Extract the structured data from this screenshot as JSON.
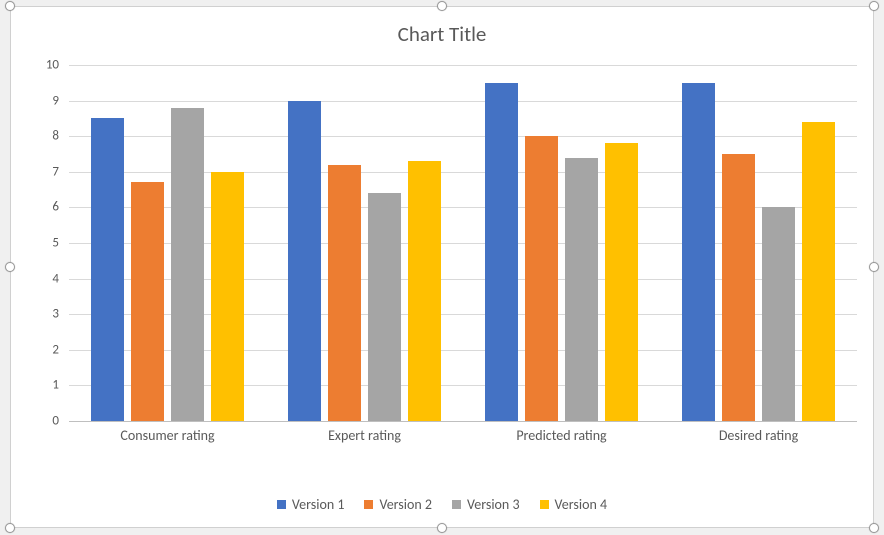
{
  "chart_data": {
    "type": "bar",
    "title": "Chart Title",
    "xlabel": "",
    "ylabel": "",
    "ylim": [
      0,
      10
    ],
    "yticks": [
      0,
      1,
      2,
      3,
      4,
      5,
      6,
      7,
      8,
      9,
      10
    ],
    "categories": [
      "Consumer rating",
      "Expert rating",
      "Predicted rating",
      "Desired rating"
    ],
    "series": [
      {
        "name": "Version 1",
        "color": "#4472c4",
        "values": [
          8.5,
          9.0,
          9.5,
          9.5
        ]
      },
      {
        "name": "Version 2",
        "color": "#ed7d31",
        "values": [
          6.7,
          7.2,
          8.0,
          7.5
        ]
      },
      {
        "name": "Version 3",
        "color": "#a5a5a5",
        "values": [
          8.8,
          6.4,
          7.4,
          6.0
        ]
      },
      {
        "name": "Version 4",
        "color": "#ffc000",
        "values": [
          7.0,
          7.3,
          7.8,
          8.4
        ]
      }
    ],
    "legend_position": "bottom",
    "grid": true
  }
}
